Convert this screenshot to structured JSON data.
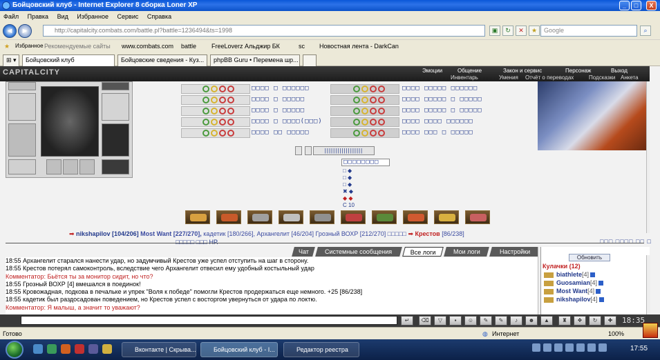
{
  "window": {
    "title": "Бойцовский клуб - Internet Explorer 8 сборка Loner XP",
    "min": "_",
    "max": "□",
    "close": "X"
  },
  "menu": [
    "Файл",
    "Правка",
    "Вид",
    "Избранное",
    "Сервис",
    "Справка"
  ],
  "nav": {
    "back": "◄",
    "forward": "►",
    "address": "http://capitalcity.combats.com/battle.pl?battle=1236494&ts=1998",
    "search_placeholder": "Google"
  },
  "favorites": [
    {
      "label": "Избранное"
    },
    {
      "label": "Рекомендуемые сайты"
    },
    {
      "label": "www.combats.com"
    },
    {
      "label": "battle"
    },
    {
      "label": "FreeLoverz Альджир БК"
    },
    {
      "label": "sc"
    },
    {
      "label": "Новостная лента - DarkCan"
    }
  ],
  "tabs": [
    {
      "label": "Бойцовский клуб",
      "active": true
    },
    {
      "label": "Бойцовские сведения - Куз...",
      "active": false
    },
    {
      "label": "phpBB Guru • Перемена шр...",
      "active": false
    }
  ],
  "game": {
    "logo": "CAPITALCITY",
    "nav_top": [
      "Эмоции",
      "Общение",
      "Закон и сервис",
      "Персонаж",
      "Выход"
    ],
    "nav_bottom": [
      "Инвентарь",
      "Умения",
      "Отчёт о переводах",
      "Подсказки",
      "Анкета"
    ],
    "stat_left": [
      "□□□□ □ □□□□□□",
      "□□□□ □ □□□□□",
      "□□□□ □ □□□□□",
      "□□□□ □ □□□□(□□□)",
      "□□□□ □□ □□□□□"
    ],
    "stat_right": [
      "□□□□ □□□□□ □□□□□□",
      "□□□□ □□□□□ □ □□□□□",
      "□□□□ □□□□□ □ □□□□□",
      "□□□□ □□□□ □□□□□□",
      "□□□□ □□□ □ □□□□□"
    ],
    "counter": "□□□□□□□□",
    "mini_rows": [
      "□ ◆",
      "□ ◆",
      "□ ◆",
      "✖ ◆",
      "◆ ◆",
      "С 10"
    ],
    "fight_line": [
      {
        "text": "nikshapilov [104/206]",
        "cls": "nb"
      },
      {
        "text": " Most Want [227/270], ",
        "cls": "nb"
      },
      {
        "text": "кадетик [180/266], ",
        "cls": "nb"
      },
      {
        "text": "Архангелит [46/204] ",
        "cls": "nb"
      },
      {
        "text": "Грозный ВОХР [212/270] ",
        "cls": "nb"
      },
      {
        "text": "□□□□□  ",
        "cls": "nb"
      },
      {
        "text": "Крестов",
        "cls": "err"
      },
      {
        "text": " [86/238]",
        "cls": "nb"
      }
    ],
    "page_text": "□□□ □□□□ □□ □",
    "hp_text": "□□□□□ □□□ НР.",
    "chat_tabs": [
      "Чат",
      "Системные сообщения",
      "Все логи",
      "Мои логи",
      "Настройки"
    ],
    "chat_lines": [
      "18:55 Архангелит старался нанести удар, но задумчивый Крестов уже успел отступить на шаг в сторону.",
      "18:55 Крестов потерял самоконтроль, вследствие чего Архангелит отвесил ему удобный костыльный удар",
      "Комментатор: Бьётся ты за монитор сидит, но что?",
      "18:55 Грозный ВОХР [4] вмешался в поединок!",
      "18:55 Кровожадная, подкова в печальке и упрек \"Воля к победе\" помогли Крестов продержаться еще немного. +25 [86/238]",
      "18:55 кадетик был раздосадован поведением, но Крестов успел с восторгом увернуться от удара по локтю.",
      "Комментатор: Я малыш, а значит то уважают?"
    ],
    "refresh_label": "Обновить",
    "users_header": "Кулачки (12)",
    "users": [
      {
        "name": "biathlete",
        "level": "[4]"
      },
      {
        "name": "Guosamian",
        "level": "[4]"
      },
      {
        "name": "Most Want",
        "level": "[4]"
      },
      {
        "name": "nikshapilov",
        "level": "[4]"
      }
    ],
    "clock": "18:35"
  },
  "status": {
    "left": "Готово",
    "zone": "Интернет",
    "zoom": "100%"
  },
  "taskbar": {
    "items": [
      {
        "label": "Вконтакте | Скрыва...",
        "active": false
      },
      {
        "label": "Бойцовский клуб - I...",
        "active": true
      },
      {
        "label": "Редактор реестра",
        "active": false
      }
    ],
    "time": "17:55"
  }
}
